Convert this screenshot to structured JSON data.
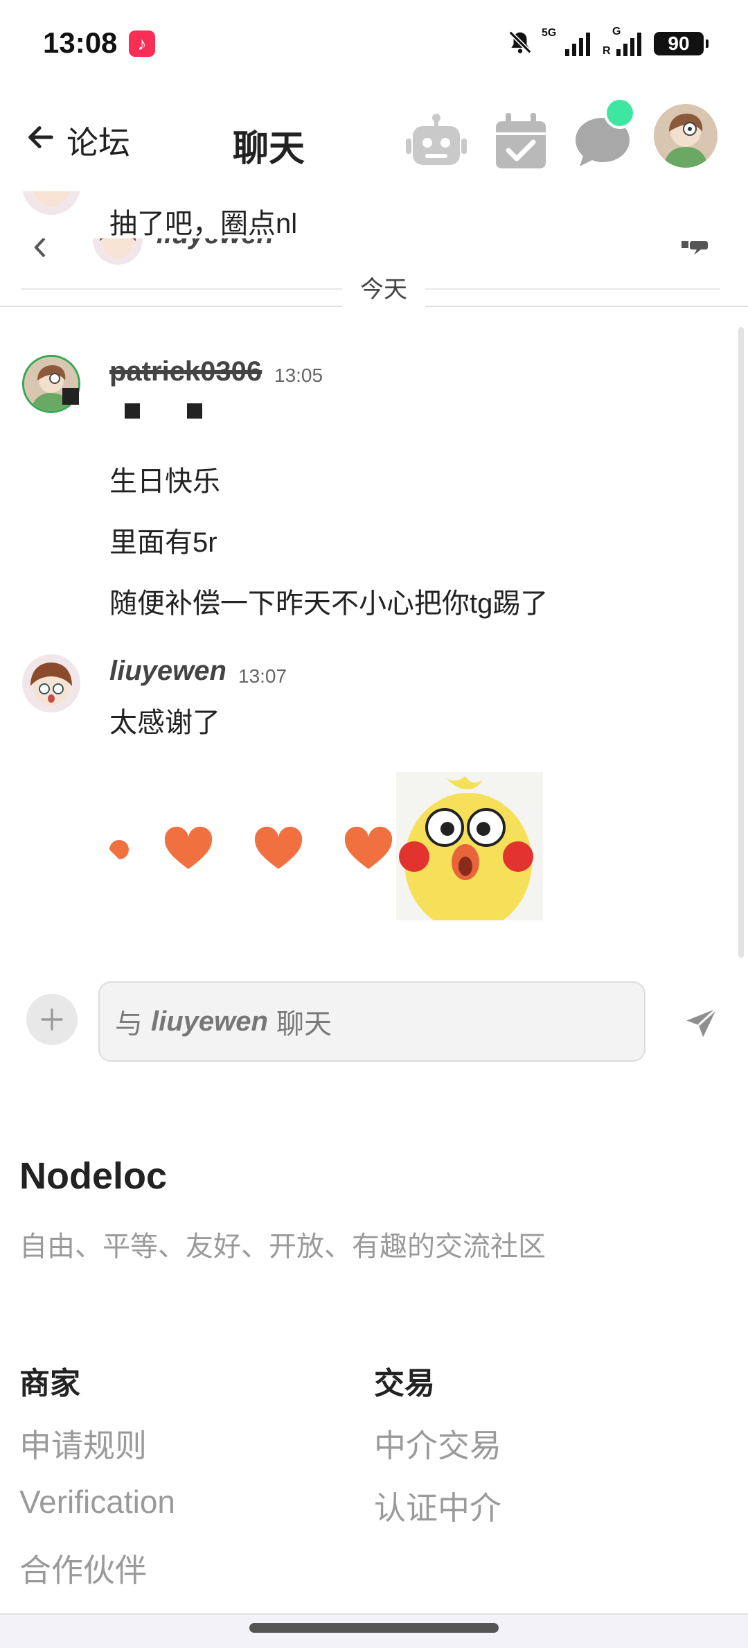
{
  "status_bar": {
    "time": "13:08",
    "network_1": "5G",
    "network_2_top": "G",
    "network_2_bottom": "R",
    "battery": "90"
  },
  "header": {
    "back_label": "论坛",
    "title": "聊天"
  },
  "chat": {
    "previous": {
      "message": "抽了吧，圈点nl",
      "reply_username": "liuyewen"
    },
    "date_divider": "今天",
    "messages": [
      {
        "username": "patrick0306",
        "time": "13:05",
        "lines": [
          "生日快乐",
          "里面有5r",
          "随便补偿一下昨天不小心把你tg踢了"
        ]
      },
      {
        "username": "liuyewen",
        "time": "13:07",
        "lines": [
          "太感谢了"
        ]
      }
    ]
  },
  "composer": {
    "placeholder_prefix": "与",
    "placeholder_user": "liuyewen",
    "placeholder_suffix": "聊天"
  },
  "footer": {
    "site_name": "Nodeloc",
    "tagline": "自由、平等、友好、开放、有趣的交流社区",
    "columns": [
      {
        "heading": "商家",
        "links": [
          "申请规则",
          "Verification",
          "合作伙伴"
        ]
      },
      {
        "heading": "交易",
        "links": [
          "中介交易",
          "认证中介"
        ]
      }
    ]
  },
  "colors": {
    "accent_dot": "#3fe6a2",
    "heart": "#f07040",
    "music_app": "#fa2d55"
  }
}
